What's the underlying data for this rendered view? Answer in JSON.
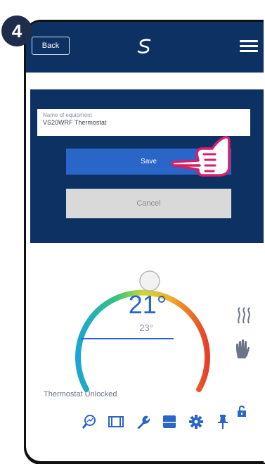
{
  "step": {
    "number": "4"
  },
  "header": {
    "back_label": "Back",
    "logo": "salus-logo-icon",
    "menu": "hamburger-menu-icon"
  },
  "edit_panel": {
    "field_label": "Name of equipment",
    "field_value": "VS20WRF Thermostat",
    "save_label": "Save",
    "cancel_label": "Cancel"
  },
  "thermostat": {
    "current_temp": "21°",
    "set_temp": "23°",
    "status_text": "Thermostat Unlocked",
    "mode_icons": [
      "heating-icon",
      "manual-mode-hand-icon"
    ],
    "lock_icon": "unlocked-padlock-icon"
  },
  "toolbar": {
    "icons": [
      "search-graph-icon",
      "schedule-icon",
      "settings-wrench-icon",
      "display-icon",
      "gear-icon",
      "pin-icon"
    ]
  },
  "colors": {
    "navy": "#0e3163",
    "accent_blue": "#2a66c8",
    "cancel_gray": "#d9d9d9",
    "pointer_pink": "#d61f6a"
  }
}
